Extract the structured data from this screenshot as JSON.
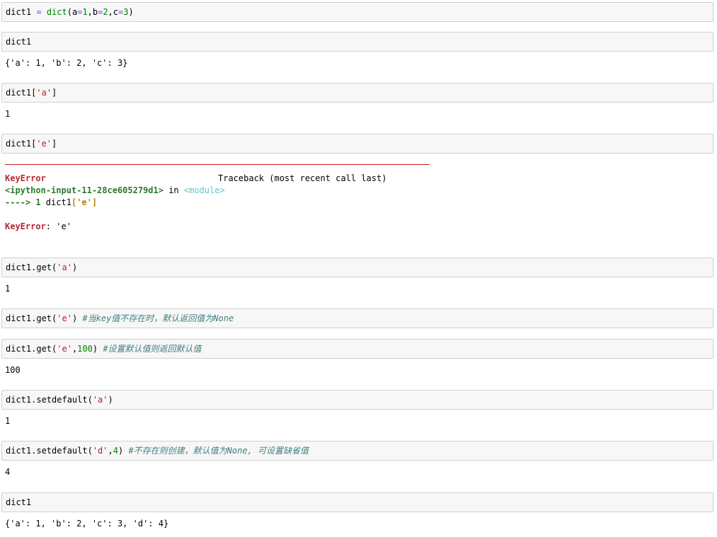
{
  "cells": [
    {
      "parts": [
        "dict1 ",
        "=",
        " ",
        "dict",
        "(a",
        "=",
        "1",
        ",b",
        "=",
        "2",
        ",c",
        "=",
        "3",
        ")"
      ]
    },
    {
      "parts": [
        "dict1"
      ],
      "output": "{'a': 1, 'b': 2, 'c': 3}"
    },
    {
      "parts": [
        "dict1[",
        "'a'",
        "]"
      ],
      "output": "1"
    },
    {
      "parts": [
        "dict1[",
        "'e'",
        "]"
      ]
    },
    {
      "parts": [
        "dict1.get(",
        "'a'",
        ")"
      ],
      "output": "1"
    },
    {
      "parts": [
        "dict1.get(",
        "'e'",
        ") ",
        "#当key值不存在时，默认返回值为None"
      ]
    },
    {
      "parts": [
        "dict1.get(",
        "'e'",
        ",",
        "100",
        ") ",
        "#设置默认值则返回默认值"
      ],
      "output": "100"
    },
    {
      "parts": [
        "dict1.setdefault(",
        "'a'",
        ")"
      ],
      "output": "1"
    },
    {
      "parts": [
        "dict1.setdefault(",
        "'d'",
        ",",
        "4",
        ") ",
        "#不存在则创建，默认值为None, 可设置缺省值"
      ],
      "output": "4"
    },
    {
      "parts": [
        "dict1"
      ],
      "output": "{'a': 1, 'b': 2, 'c': 3, 'd': 4}"
    }
  ],
  "traceback": {
    "error_name": "KeyError",
    "header_right": "Traceback (most recent call last)",
    "input_ref": "<ipython-input-11-28ce605279d1>",
    "in_word": " in ",
    "module_ref": "<module>",
    "arrow": "----> 1",
    "arrow_code": " dict1",
    "arrow_bracket_open": "[",
    "arrow_str": "'e'",
    "arrow_bracket_close": "]",
    "final_error": "KeyError",
    "final_message": ": 'e'"
  }
}
